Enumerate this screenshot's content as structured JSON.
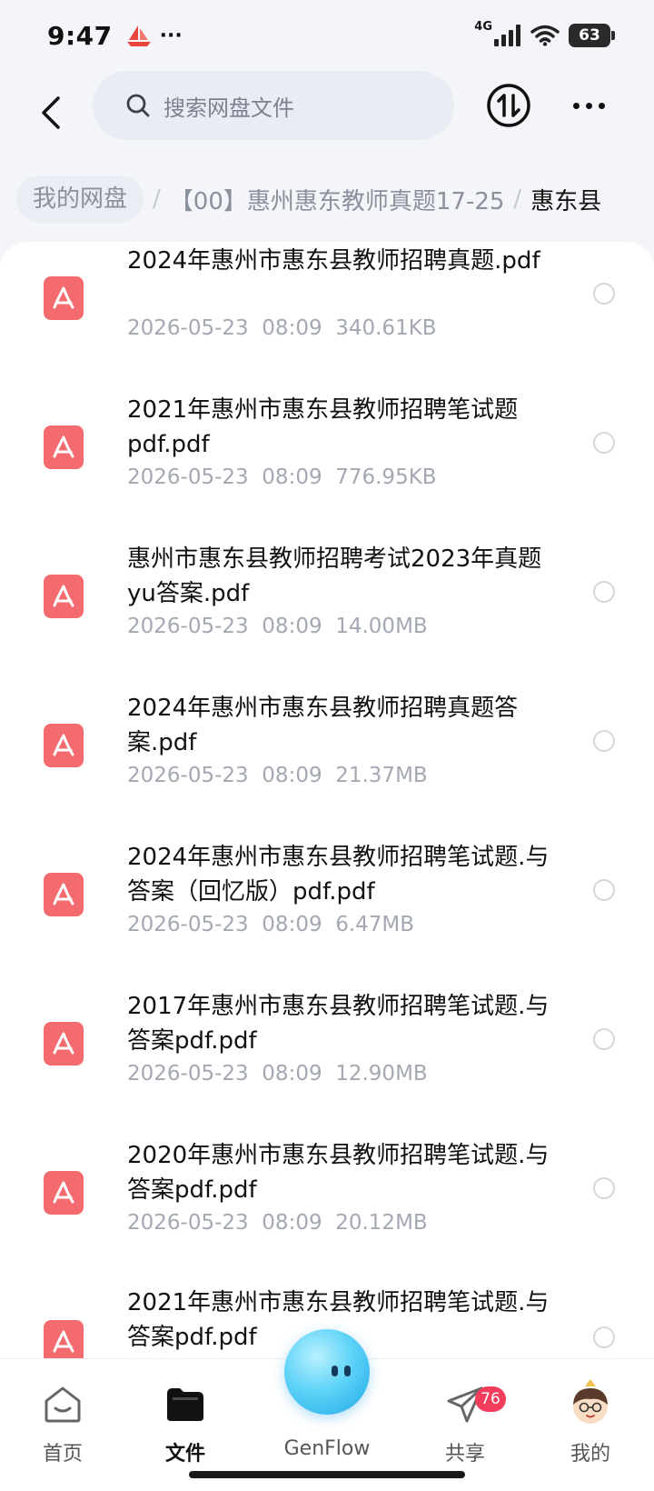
{
  "status_bar": {
    "time": "9:47",
    "dots": "···",
    "network": "4G",
    "battery": "63"
  },
  "header": {
    "search_placeholder": "搜索网盘文件",
    "back_icon": "chevron-left-icon",
    "sort_icon": "sort-updown-icon",
    "more_icon": "more-horizontal-icon"
  },
  "breadcrumb": {
    "root": "我的网盘",
    "separator": "/",
    "middle": "【00】惠州惠东教师真题17-25",
    "current": "惠东县"
  },
  "files": [
    {
      "name": "2024年惠州市惠东县教师招聘真题.pdf",
      "date": "2026-05-23",
      "time": "08:09",
      "size": "340.61KB"
    },
    {
      "name": "2021年惠州市惠东县教师招聘笔试题pdf.pdf",
      "date": "2026-05-23",
      "time": "08:09",
      "size": "776.95KB"
    },
    {
      "name": "惠州市惠东县教师招聘考试2023年真题yu答案.pdf",
      "date": "2026-05-23",
      "time": "08:09",
      "size": "14.00MB"
    },
    {
      "name": "2024年惠州市惠东县教师招聘真题答案.pdf",
      "date": "2026-05-23",
      "time": "08:09",
      "size": "21.37MB"
    },
    {
      "name": "2024年惠州市惠东县教师招聘笔试题.与答案（回忆版）pdf.pdf",
      "date": "2026-05-23",
      "time": "08:09",
      "size": "6.47MB"
    },
    {
      "name": "2017年惠州市惠东县教师招聘笔试题.与答案pdf.pdf",
      "date": "2026-05-23",
      "time": "08:09",
      "size": "12.90MB"
    },
    {
      "name": "2020年惠州市惠东县教师招聘笔试题.与答案pdf.pdf",
      "date": "2026-05-23",
      "time": "08:09",
      "size": "20.12MB"
    },
    {
      "name": "2021年惠州市惠东县教师招聘笔试题.与答案pdf.pdf",
      "date": "",
      "time": "",
      "size": ""
    }
  ],
  "bottom_nav": {
    "home": "首页",
    "files": "文件",
    "genflow": "GenFlow",
    "share": "共享",
    "share_badge": "76",
    "mine": "我的"
  },
  "colors": {
    "pdf_red": "#f36b6e",
    "badge_red": "#f23d5c",
    "meta_gray": "#a3a8b2"
  }
}
